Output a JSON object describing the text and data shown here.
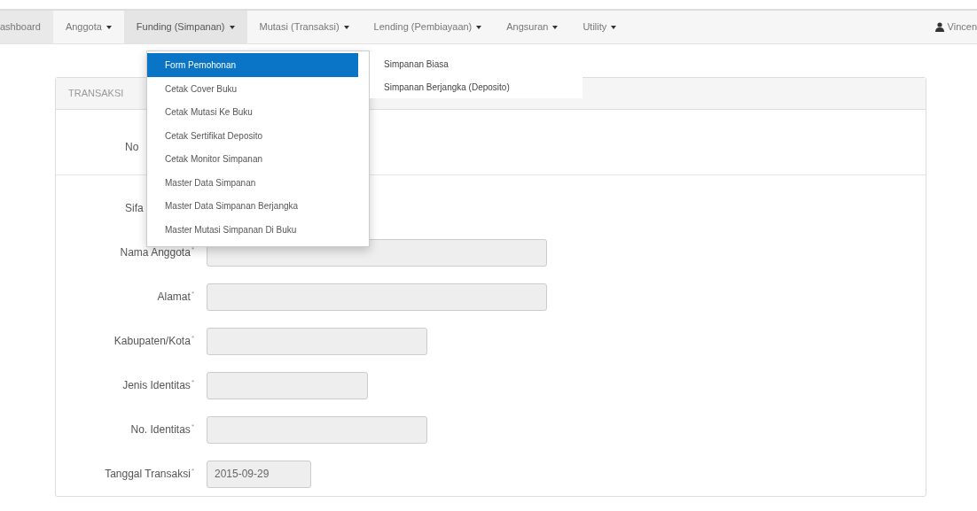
{
  "navbar": {
    "items": [
      {
        "label": "ashboard",
        "dropdown": false,
        "selected": false,
        "kind": "home"
      },
      {
        "label": "Anggota",
        "dropdown": true,
        "selected": false
      },
      {
        "label": "Funding (Simpanan)",
        "dropdown": true,
        "selected": true
      },
      {
        "label": "Mutasi (Transaksi)",
        "dropdown": true,
        "selected": false
      },
      {
        "label": "Lending (Pembiayaan)",
        "dropdown": true,
        "selected": false
      },
      {
        "label": "Angsuran",
        "dropdown": true,
        "selected": false
      },
      {
        "label": "Utility",
        "dropdown": true,
        "selected": false
      }
    ],
    "user": "Vincen"
  },
  "dropdown_menu": {
    "items": [
      {
        "label": "Form Pemohonan",
        "selected": true
      },
      {
        "label": "Cetak Cover Buku",
        "selected": false
      },
      {
        "label": "Cetak Mutasi Ke Buku",
        "selected": false
      },
      {
        "label": "Cetak Sertifikat Deposito",
        "selected": false
      },
      {
        "label": "Cetak Monitor Simpanan",
        "selected": false
      },
      {
        "label": "Master Data Simpanan",
        "selected": false
      },
      {
        "label": "Master Data Simpanan Berjangka",
        "selected": false
      },
      {
        "label": "Master Mutasi Simpanan Di Buku",
        "selected": false
      }
    ],
    "submenu": [
      "Simpanan Biasa",
      "Simpanan Berjangka (Deposito)"
    ]
  },
  "card": {
    "title": "TRANSAKSI",
    "rows": [
      {
        "kind": "covered",
        "label": "No"
      },
      {
        "kind": "divider"
      },
      {
        "kind": "covered",
        "label": "Sifa"
      },
      {
        "kind": "field",
        "label": "Nama Anggota",
        "marker": "*"
      },
      {
        "kind": "field",
        "label": "Alamat",
        "marker": "*"
      },
      {
        "kind": "field",
        "label": "Kabupaten/Kota",
        "marker": "*"
      },
      {
        "kind": "field",
        "label": "Jenis Identitas",
        "marker": "*"
      },
      {
        "kind": "field",
        "label": "No. Identitas",
        "marker": "*"
      },
      {
        "kind": "field",
        "label": "Tanggal Transaksi",
        "marker": "*",
        "value": "2015-09-29"
      }
    ]
  }
}
